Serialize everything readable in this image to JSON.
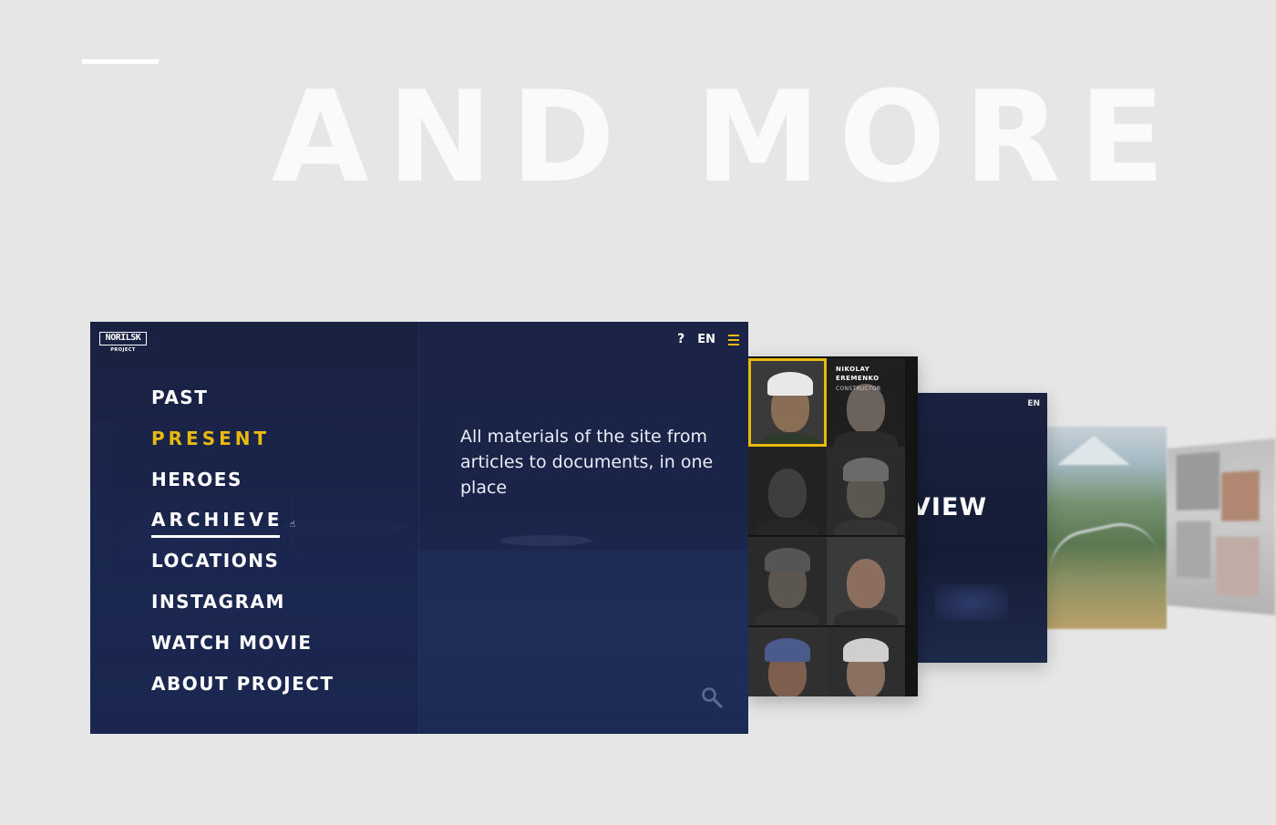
{
  "headline": "AND MORE",
  "menu_screen": {
    "logo": {
      "title": "NORILSK",
      "subtitle": "PROJECT"
    },
    "controls": {
      "help": "?",
      "language": "EN"
    },
    "menu_items": [
      {
        "label": "PAST"
      },
      {
        "label": "PRESENT"
      },
      {
        "label": "HEROES"
      },
      {
        "label": "ARCHIEVE"
      },
      {
        "label": "LOCATIONS"
      },
      {
        "label": "INSTAGRAM"
      },
      {
        "label": "WATCH MOVIE"
      },
      {
        "label": "ABOUT PROJECT"
      }
    ],
    "description": "All materials of the site from articles to documents, in one place",
    "accent_color": "#e8b90f",
    "background_color": "#1b2446"
  },
  "heroes_card": {
    "featured": {
      "first_name": "NIKOLAY",
      "last_name": "EREMENKO",
      "role": "CONSTRUCTOR"
    }
  },
  "movie_card": {
    "language": "EN",
    "title_fragment": "VIEW"
  },
  "icons": [
    "hamburger-icon",
    "search-icon",
    "cursor-icon"
  ]
}
